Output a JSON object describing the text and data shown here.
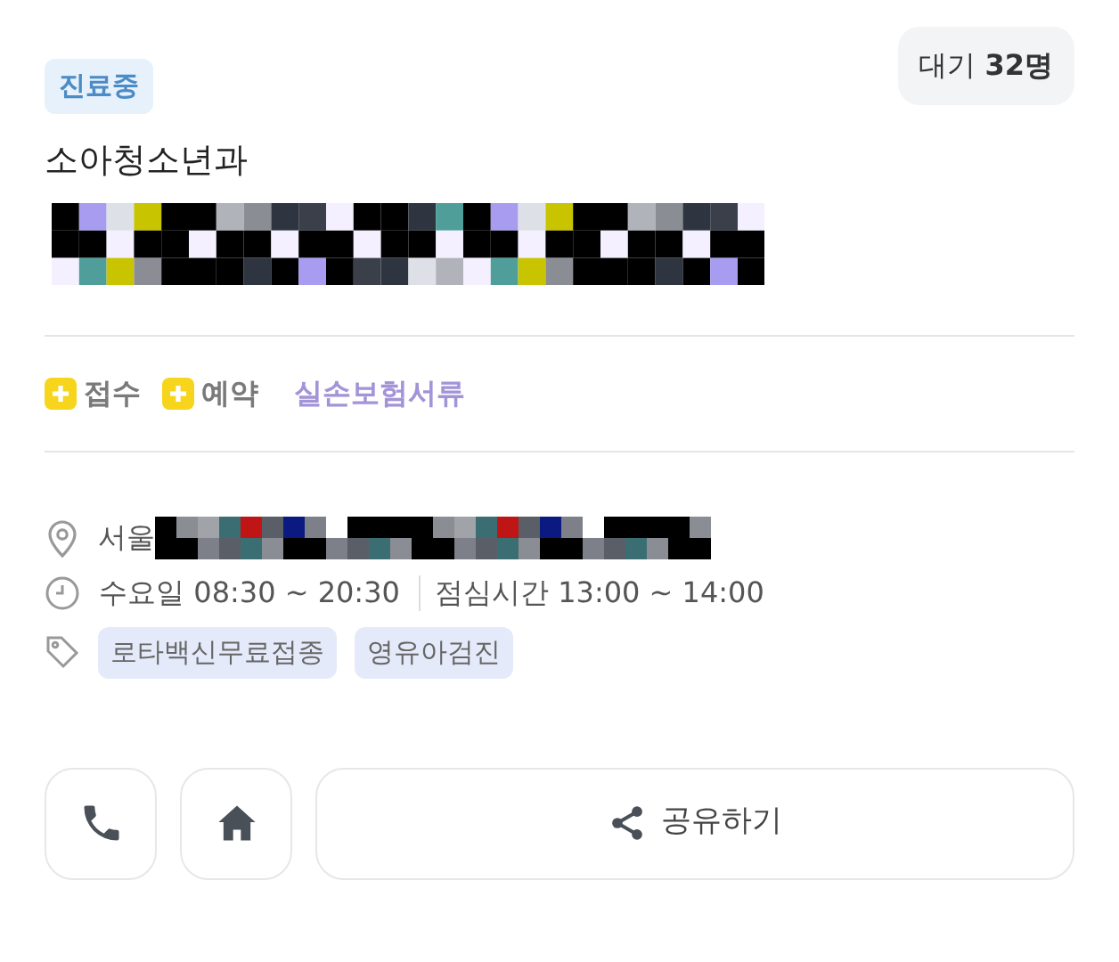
{
  "status_badge": {
    "label": "진료중"
  },
  "waiting": {
    "label": "대기 **32명**"
  },
  "department": "소아청소년과",
  "actions": [
    {
      "kind": "plus",
      "label": "접수"
    },
    {
      "kind": "plus",
      "label": "예약"
    },
    {
      "kind": "link",
      "label": "실손보험서류"
    }
  ],
  "info": {
    "address": "서울",
    "hours": "수요일 08:30 ~ 20:30",
    "lunch": "점심시간 13:00 ~ 14:00",
    "tags": [
      "로타백신무료접종",
      "영유아검진"
    ]
  },
  "buttons": [
    {
      "kind": "phone"
    },
    {
      "kind": "home"
    },
    {
      "kind": "share",
      "label": "공유하기"
    }
  ]
}
